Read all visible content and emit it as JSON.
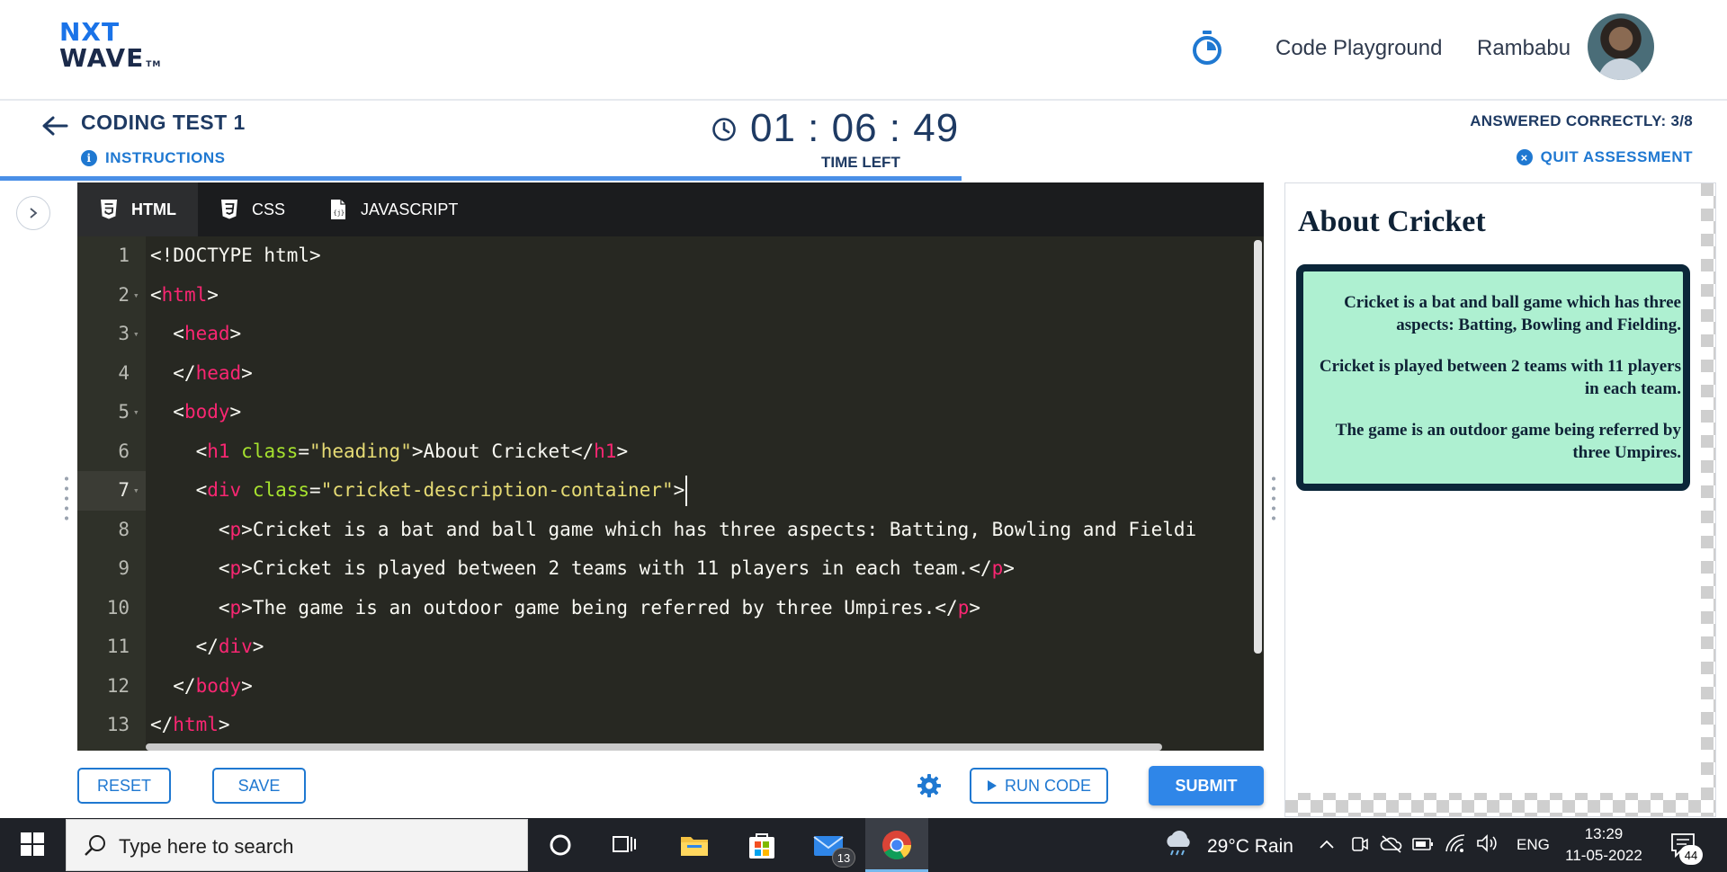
{
  "brand": {
    "logo_line1": "NXT",
    "logo_line2": "WAVE",
    "logo_tm": "TM"
  },
  "topnav": {
    "link": "Code Playground",
    "user": "Rambabu"
  },
  "assessment": {
    "title": "CODING TEST 1",
    "instructions": "INSTRUCTIONS",
    "timer": "01 : 06 : 49",
    "timer_label": "TIME LEFT",
    "answered": "ANSWERED CORRECTLY: 3/8",
    "quit": "QUIT ASSESSMENT",
    "progress_fraction": 0.557
  },
  "editor": {
    "tabs": [
      {
        "label": "HTML",
        "icon": "html5-icon",
        "active": true
      },
      {
        "label": "CSS",
        "icon": "css3-icon",
        "active": false
      },
      {
        "label": "JAVASCRIPT",
        "icon": "js-file-icon",
        "active": false
      }
    ],
    "line_numbers": [
      "1",
      "2",
      "3",
      "4",
      "5",
      "6",
      "7",
      "8",
      "9",
      "10",
      "11",
      "12",
      "13"
    ],
    "lines": [
      [
        [
          "p",
          "<!DOCTYPE html>"
        ]
      ],
      [
        [
          "p",
          "<"
        ],
        [
          "t",
          "html"
        ],
        [
          "p",
          ">"
        ]
      ],
      [
        [
          "p",
          "  <"
        ],
        [
          "t",
          "head"
        ],
        [
          "p",
          ">"
        ]
      ],
      [
        [
          "p",
          "  </"
        ],
        [
          "t",
          "head"
        ],
        [
          "p",
          ">"
        ]
      ],
      [
        [
          "p",
          "  <"
        ],
        [
          "t",
          "body"
        ],
        [
          "p",
          ">"
        ]
      ],
      [
        [
          "p",
          "    <"
        ],
        [
          "t",
          "h1"
        ],
        [
          "p",
          " "
        ],
        [
          "a",
          "class"
        ],
        [
          "p",
          "="
        ],
        [
          "s",
          "\"heading\""
        ],
        [
          "p",
          ">About Cricket</"
        ],
        [
          "t",
          "h1"
        ],
        [
          "p",
          ">"
        ]
      ],
      [
        [
          "p",
          "    <"
        ],
        [
          "t",
          "div"
        ],
        [
          "p",
          " "
        ],
        [
          "a",
          "class"
        ],
        [
          "p",
          "="
        ],
        [
          "s",
          "\"cricket-description-container\""
        ],
        [
          "p",
          ">"
        ]
      ],
      [
        [
          "p",
          "      <"
        ],
        [
          "t",
          "p"
        ],
        [
          "p",
          ">Cricket is a bat and ball game which has three aspects: Batting, Bowling and Fieldi"
        ]
      ],
      [
        [
          "p",
          "      <"
        ],
        [
          "t",
          "p"
        ],
        [
          "p",
          ">Cricket is played between 2 teams with 11 players in each team.</"
        ],
        [
          "t",
          "p"
        ],
        [
          "p",
          ">"
        ]
      ],
      [
        [
          "p",
          "      <"
        ],
        [
          "t",
          "p"
        ],
        [
          "p",
          ">The game is an outdoor game being referred by three Umpires.</"
        ],
        [
          "t",
          "p"
        ],
        [
          "p",
          ">"
        ]
      ],
      [
        [
          "p",
          "    </"
        ],
        [
          "t",
          "div"
        ],
        [
          "p",
          ">"
        ]
      ],
      [
        [
          "p",
          "  </"
        ],
        [
          "t",
          "body"
        ],
        [
          "p",
          ">"
        ]
      ],
      [
        [
          "p",
          "</"
        ],
        [
          "t",
          "html"
        ],
        [
          "p",
          ">"
        ]
      ]
    ],
    "fold_lines": [
      2,
      3,
      5,
      7
    ],
    "active_line": 7
  },
  "actions": {
    "reset": "RESET",
    "save": "SAVE",
    "run": "RUN CODE",
    "submit": "SUBMIT"
  },
  "preview": {
    "heading": "About Cricket",
    "paragraphs": [
      "Cricket is a bat and ball game which has three aspects: Batting, Bowling and Fielding.",
      "Cricket is played between 2 teams with 11 players in each team.",
      "The game is an outdoor game being referred by three Umpires."
    ]
  },
  "taskbar": {
    "search_placeholder": "Type here to search",
    "mail_badge": "13",
    "weather": "29°C  Rain",
    "lang": "ENG",
    "time": "13:29",
    "date": "11-05-2022",
    "notif_badge": "44"
  },
  "colors": {
    "accent": "#1f78d1",
    "navy": "#1e3a63",
    "editor_bg": "#272822",
    "preview_box": "#aef0d1",
    "preview_border": "#0b2639"
  }
}
